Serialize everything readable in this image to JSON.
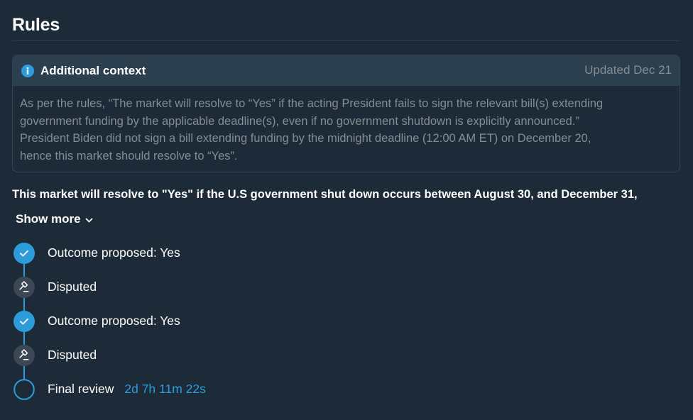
{
  "rules": {
    "title": "Rules",
    "additional_context": {
      "title": "Additional context",
      "updated": "Updated Dec 21",
      "body": "As per the rules, “The market will resolve to “Yes” if the acting President fails to sign the relevant bill(s) extending\ngovernment funding by the applicable deadline(s), even if no government shutdown is explicitly announced.”\nPresident Biden did not sign a bill extending funding by the midnight deadline (12:00 AM ET) on December 20,\nhence this market should resolve to “Yes”."
    },
    "description": "This market will resolve to \"Yes\" if the U.S government shut down occurs between August 30, and December 31,",
    "show_more_label": "Show more"
  },
  "timeline": {
    "steps": [
      {
        "label": "Outcome proposed: Yes",
        "icon": "check-circle-icon",
        "status": "done"
      },
      {
        "label": "Disputed",
        "icon": "gavel-icon",
        "status": "disputed"
      },
      {
        "label": "Outcome proposed: Yes",
        "icon": "check-circle-icon",
        "status": "done"
      },
      {
        "label": "Disputed",
        "icon": "gavel-icon",
        "status": "disputed"
      },
      {
        "label": "Final review",
        "icon": "empty-circle-icon",
        "status": "pending",
        "timer": "2d 7h 11m 22s"
      }
    ]
  },
  "colors": {
    "background": "#1d2b39",
    "accent": "#2d9cdb",
    "muted_text": "#858d92",
    "context_header": "#2c3f4f",
    "disputed_icon_bg": "#3b4754"
  }
}
